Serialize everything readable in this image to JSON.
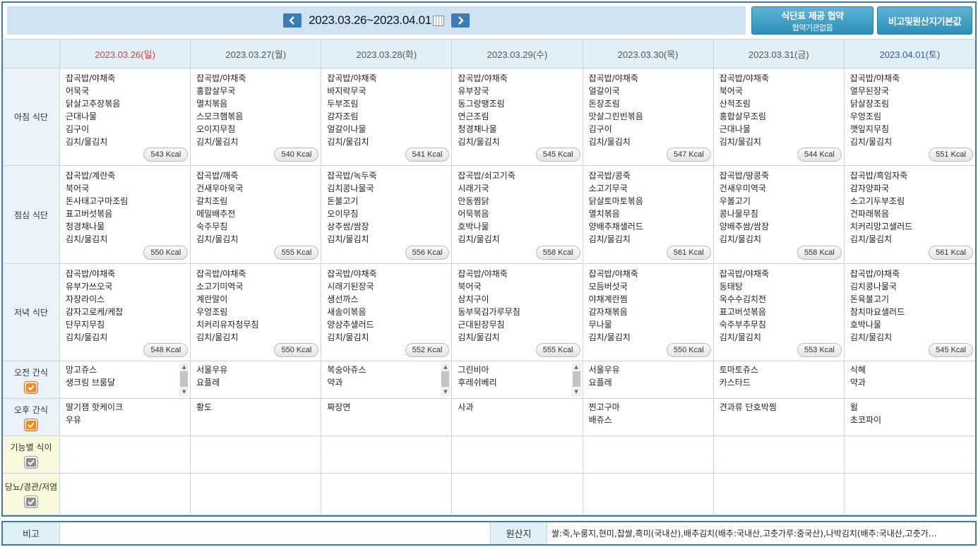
{
  "header": {
    "week_range": "2023.03.26~2023.04.01",
    "contract_btn_main": "식단표 제공 협약",
    "contract_btn_sub": "협약기관없음",
    "origin_btn": "비고및원산지기본값"
  },
  "days": [
    {
      "label": "2023.03.26(일)",
      "breakfast": [
        "잡곡밥/야채죽",
        "어묵국",
        "닭살고추장볶음",
        "근대나물",
        "김구이",
        "김치/물김치"
      ],
      "breakfast_kcal": "543 Kcal",
      "lunch": [
        "잡곡밥/계란죽",
        "북어국",
        "돈사태고구마조림",
        "표고버섯볶음",
        "청경채나물",
        "김치/물김치"
      ],
      "lunch_kcal": "550 Kcal",
      "dinner": [
        "잡곡밥/야채죽",
        "유부가쓰오국",
        "자장라이스",
        "감자고로케/케찹",
        "단무지무침",
        "김치/물김치"
      ],
      "dinner_kcal": "548 Kcal",
      "am_snack": [
        "망고쥬스",
        "생크림 브룸달"
      ],
      "pm_snack": [
        "딸기잼 핫케이크",
        "우유"
      ]
    },
    {
      "label": "2023.03.27(월)",
      "breakfast": [
        "잡곡밥/야채죽",
        "홍합살무국",
        "멸치볶음",
        "스모크햄볶음",
        "오이지무침",
        "김치/물김치"
      ],
      "breakfast_kcal": "540 Kcal",
      "lunch": [
        "잡곡밥/깨죽",
        "건새우아욱국",
        "갈치조림",
        "메밀배추전",
        "숙주무침",
        "김치/물김치"
      ],
      "lunch_kcal": "555 Kcal",
      "dinner": [
        "잡곡밥/야채죽",
        "소고기미역국",
        "계란말이",
        "우엉조림",
        "치커리유자청무침",
        "김치/물김치"
      ],
      "dinner_kcal": "550 Kcal",
      "am_snack": [
        "서울우유",
        "요플레"
      ],
      "pm_snack": [
        "황도"
      ]
    },
    {
      "label": "2023.03.28(화)",
      "breakfast": [
        "잡곡밥/야채죽",
        "바지락무국",
        "두부조림",
        "감자조림",
        "얼갈이나물",
        "김치/물김치"
      ],
      "breakfast_kcal": "541 Kcal",
      "lunch": [
        "잡곡밥/녹두죽",
        "김치콩나물국",
        "돈불고기",
        "오이무침",
        "상추쌈/쌈장",
        "김치/물김치"
      ],
      "lunch_kcal": "556 Kcal",
      "dinner": [
        "잡곡밥/야채죽",
        "시래기된장국",
        "생선까스",
        "새송이볶음",
        "양상추샐러드",
        "김치/물김치"
      ],
      "dinner_kcal": "552 Kcal",
      "am_snack": [
        "복숭아쥬스",
        "약과"
      ],
      "pm_snack": [
        "짜장면"
      ]
    },
    {
      "label": "2023.03.29(수)",
      "breakfast": [
        "잡곡밥/야채죽",
        "유부장국",
        "동그랑땡조림",
        "연근조림",
        "청경채나물",
        "김치/물김치"
      ],
      "breakfast_kcal": "545 Kcal",
      "lunch": [
        "잡곡밥/쇠고기죽",
        "시래기국",
        "안동찜닭",
        "어묵볶음",
        "호박나물",
        "김치/물김치"
      ],
      "lunch_kcal": "558 Kcal",
      "dinner": [
        "잡곡밥/야채죽",
        "북어국",
        "삼치구이",
        "동부묵김가루무침",
        "근대된장무침",
        "김치/물김치"
      ],
      "dinner_kcal": "555 Kcal",
      "am_snack": [
        "그린비아",
        "후레쉬베리"
      ],
      "pm_snack": [
        "사과"
      ]
    },
    {
      "label": "2023.03.30(목)",
      "breakfast": [
        "잡곡밥/야채죽",
        "얼갈이국",
        "돈장조림",
        "맛살그린빈볶음",
        "김구이",
        "김치/물김치"
      ],
      "breakfast_kcal": "547 Kcal",
      "lunch": [
        "잡곡밥/콩죽",
        "소고기무국",
        "닭살토마토볶음",
        "멸치볶음",
        "양배추채샐러드",
        "김치/물김치"
      ],
      "lunch_kcal": "561 Kcal",
      "dinner": [
        "잡곡밥/야채죽",
        "모듬버섯국",
        "야채계란찜",
        "감자채볶음",
        "무나물",
        "김치/물김치"
      ],
      "dinner_kcal": "550 Kcal",
      "am_snack": [
        "서울우유",
        "요플레"
      ],
      "pm_snack": [
        "찐고구마",
        "배쥬스"
      ]
    },
    {
      "label": "2023.03.31(금)",
      "breakfast": [
        "잡곡밥/야채죽",
        "북어국",
        "산적조림",
        "홍합살무조림",
        "근대나물",
        "김치/물김치"
      ],
      "breakfast_kcal": "544 Kcal",
      "lunch": [
        "잡곡밥/땅콩죽",
        "건새우미역국",
        "우볼고기",
        "콩나물무침",
        "양배추쌈/쌈장",
        "김치/물김치"
      ],
      "lunch_kcal": "558 Kcal",
      "dinner": [
        "잡곡밥/야채죽",
        "동태탕",
        "옥수수김치전",
        "표고버섯볶음",
        "숙주부추무침",
        "김치/물김치"
      ],
      "dinner_kcal": "553 Kcal",
      "am_snack": [
        "토마토쥬스",
        "카스타드"
      ],
      "pm_snack": [
        "견과류 단호박찜"
      ]
    },
    {
      "label": "2023.04.01(토)",
      "breakfast": [
        "잡곡밥/야채죽",
        "열무된장국",
        "닭살장조림",
        "우엉조림",
        "깻잎지무침",
        "김치/물김치"
      ],
      "breakfast_kcal": "551 Kcal",
      "lunch": [
        "잡곡밥/흑임자죽",
        "감자양파국",
        "소고기두부조림",
        "건파래볶음",
        "치커리망고샐러드",
        "김치/물김치"
      ],
      "lunch_kcal": "561 Kcal",
      "dinner": [
        "잡곡밥/야채죽",
        "김치콩나물국",
        "돈육불고기",
        "참치마요샐러드",
        "호박나물",
        "김치/물김치"
      ],
      "dinner_kcal": "545 Kcal",
      "am_snack": [
        "식혜",
        "약과"
      ],
      "pm_snack": [
        "윌",
        "초코파이"
      ]
    }
  ],
  "rows": {
    "breakfast": "아침 식단",
    "lunch": "점심 식단",
    "dinner": "저녁 식단",
    "am_snack": "오전 간식",
    "pm_snack": "오후 간식",
    "functional": "기능별 식이",
    "diabetes": "당뇨/경관/저염"
  },
  "bottom": {
    "remark_label": "비고",
    "origin_label": "원산지",
    "origin_text": "쌀:죽,누룽지,현미,찹쌀,흑미(국내산),배추김치(배추:국내산,고춧가루:중국산),나박김치(배추:국내산,고춧가…"
  },
  "colors": {
    "border": "#3a78c0",
    "sunday": "#d9403b",
    "saturday": "#2b56c9",
    "button": "#2e8fb8",
    "check_on": "#f28a1e"
  }
}
